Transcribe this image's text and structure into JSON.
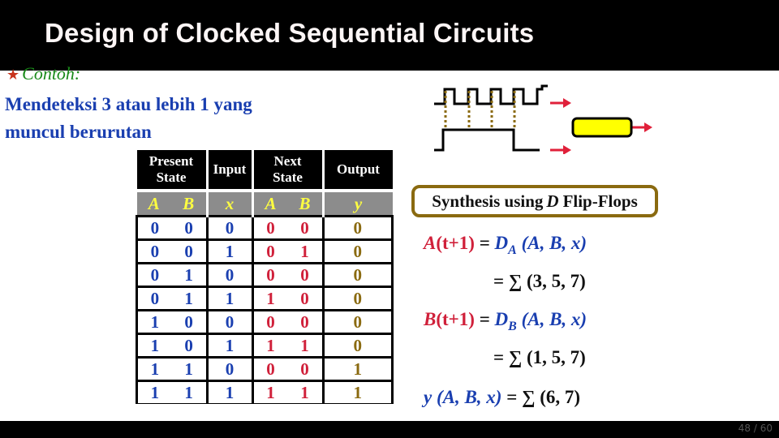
{
  "slide": {
    "title": "Design of Clocked Sequential Circuits",
    "bullet_icon": "star-icon",
    "bullet_glyph": "★",
    "example_label": "Contoh:",
    "description_line1": "Mendeteksi 3 atau lebih 1 yang",
    "description_line2": "muncul berurutan",
    "page_number": "48 / 60"
  },
  "table": {
    "headers": {
      "present": "Present State",
      "input": "Input",
      "next": "Next State",
      "output": "Output"
    },
    "vars": {
      "present_a": "A",
      "present_b": "B",
      "input_x": "x",
      "next_a": "A",
      "next_b": "B",
      "output_y": "y"
    },
    "rows": [
      {
        "A": "0",
        "B": "0",
        "x": "0",
        "nA": "0",
        "nB": "0",
        "y": "0"
      },
      {
        "A": "0",
        "B": "0",
        "x": "1",
        "nA": "0",
        "nB": "1",
        "y": "0"
      },
      {
        "A": "0",
        "B": "1",
        "x": "0",
        "nA": "0",
        "nB": "0",
        "y": "0"
      },
      {
        "A": "0",
        "B": "1",
        "x": "1",
        "nA": "1",
        "nB": "0",
        "y": "0"
      },
      {
        "A": "1",
        "B": "0",
        "x": "0",
        "nA": "0",
        "nB": "0",
        "y": "0"
      },
      {
        "A": "1",
        "B": "0",
        "x": "1",
        "nA": "1",
        "nB": "1",
        "y": "0"
      },
      {
        "A": "1",
        "B": "1",
        "x": "0",
        "nA": "0",
        "nB": "0",
        "y": "1"
      },
      {
        "A": "1",
        "B": "1",
        "x": "1",
        "nA": "1",
        "nB": "1",
        "y": "1"
      }
    ]
  },
  "diagram": {
    "name": "clock-timing-diagram",
    "colors": {
      "arrow": "#e0203a",
      "block": "#ffff00",
      "dotted": "#8a6a10"
    }
  },
  "synthesis": {
    "box_pre": "Synthesis using ",
    "box_d": "D",
    "box_post": " Flip-Flops",
    "eqA_lhs_var": "A",
    "eqA_lhs_t": "(t+1)",
    "eqA_eq": " = ",
    "eqA_D": "D",
    "eqA_sub": "A",
    "eqA_args": " (A, B, x)",
    "eqA_sum": "= ∑ (3, 5, 7)",
    "eqB_lhs_var": "B",
    "eqB_lhs_t": "(t+1)",
    "eqB_eq": " = ",
    "eqB_D": "D",
    "eqB_sub": "B",
    "eqB_args": " (A, B, x)",
    "eqB_sum": "= ∑ (1, 5, 7)",
    "eqY_var": "y",
    "eqY_args": " (A, B, x)",
    "eqY_sum": " = ∑ (6, 7)"
  }
}
